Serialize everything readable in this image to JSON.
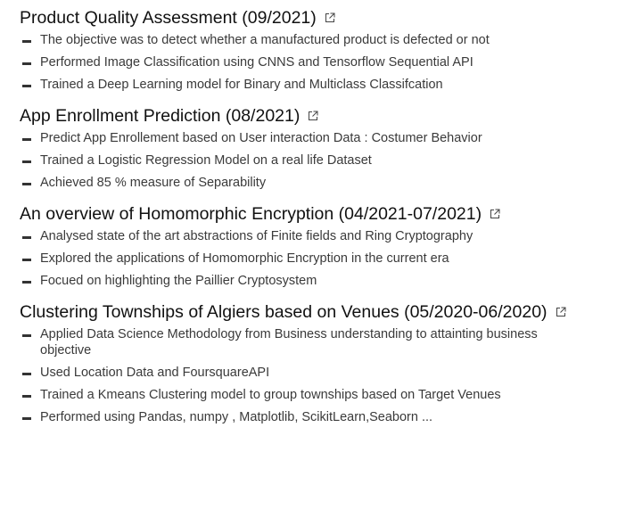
{
  "projects": [
    {
      "title": "Product Quality Assessment (09/2021)",
      "link_icon": "external-link-icon",
      "bullets": [
        "The objective was to detect whether a manufactured product is defected or not",
        "Performed Image Classification using CNNS and Tensorflow Sequential API",
        "Trained a Deep Learning model for Binary and Multiclass Classifcation"
      ]
    },
    {
      "title": "App Enrollment Prediction (08/2021)",
      "link_icon": "external-link-icon",
      "bullets": [
        "Predict App Enrollement based on User interaction Data : Costumer Behavior",
        "Trained a Logistic Regression Model on a real life Dataset",
        "Achieved 85 % measure of Separability"
      ]
    },
    {
      "title": "An overview of Homomorphic Encryption (04/2021-07/2021)",
      "link_icon": "external-link-icon",
      "bullets": [
        "Analysed state of the art abstractions of Finite fields and Ring Cryptography",
        "Explored the applications  of Homomorphic Encryption in the current era",
        "Focued on highlighting the Paillier Cryptosystem"
      ]
    },
    {
      "title": "Clustering Townships of Algiers based on Venues (05/2020-06/2020)",
      "link_icon": "external-link-icon",
      "bullets": [
        "Applied Data Science Methodology from Business understanding to attainting business objective",
        "Used Location Data and FoursquareAPI",
        "Trained a Kmeans Clustering model to group townships based on Target Venues",
        "Performed using Pandas, numpy , Matplotlib, ScikitLearn,Seaborn ..."
      ]
    }
  ]
}
